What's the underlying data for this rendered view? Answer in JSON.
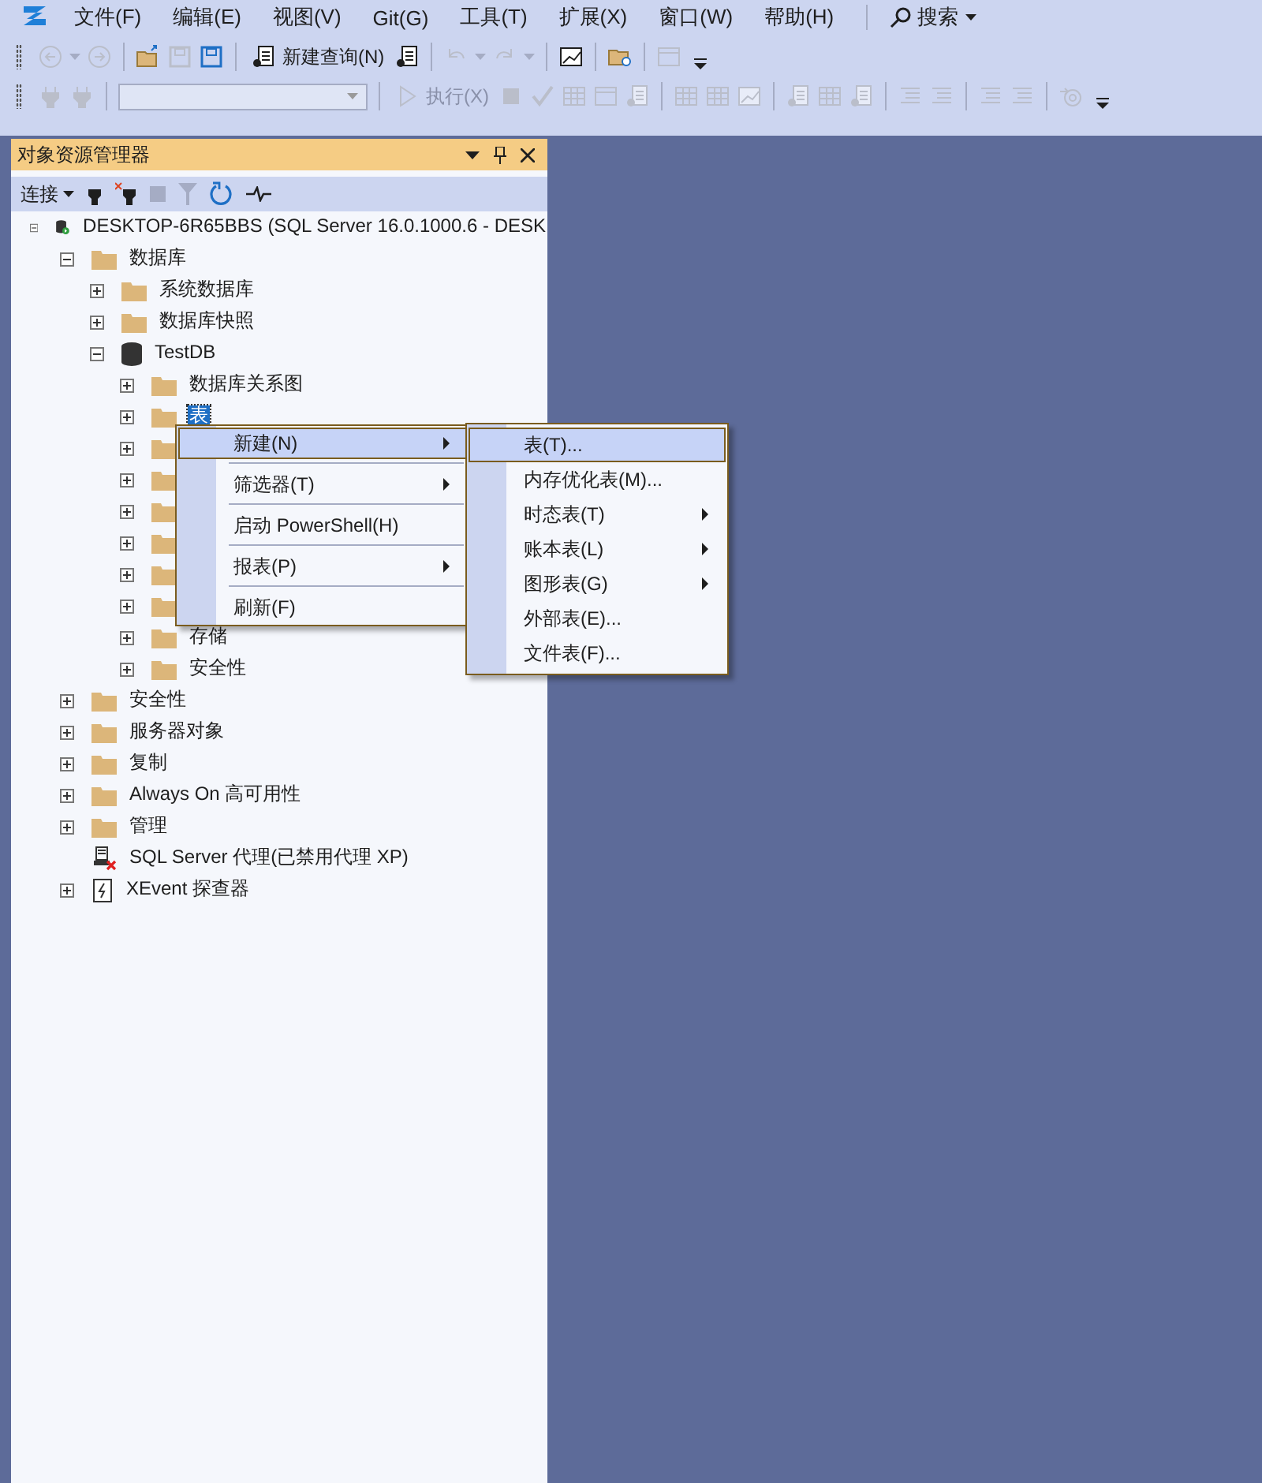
{
  "menu_bar": {
    "items": [
      "文件(F)",
      "编辑(E)",
      "视图(V)",
      "Git(G)",
      "工具(T)",
      "扩展(X)",
      "窗口(W)",
      "帮助(H)"
    ],
    "search": "搜索"
  },
  "toolbar_1": [
    {
      "kind": "icon",
      "disabled": true
    },
    {
      "kind": "caret",
      "disabled": true
    },
    {
      "kind": "icon",
      "disabled": true
    },
    {
      "kind": "separator"
    },
    {
      "kind": "icon",
      "disabled": false
    },
    {
      "kind": "icon",
      "disabled": true
    },
    {
      "kind": "icon",
      "disabled": false
    },
    {
      "kind": "separator"
    },
    {
      "kind": "button",
      "label": "新建查询(N)",
      "disabled": false
    },
    {
      "kind": "icon",
      "disabled": false
    },
    {
      "kind": "separator"
    },
    {
      "kind": "icon",
      "disabled": true
    },
    {
      "kind": "caret",
      "disabled": true
    },
    {
      "kind": "icon",
      "disabled": true
    },
    {
      "kind": "caret",
      "disabled": true
    },
    {
      "kind": "separator"
    },
    {
      "kind": "icon",
      "disabled": false
    },
    {
      "kind": "separator"
    },
    {
      "kind": "icon",
      "disabled": false
    },
    {
      "kind": "separator"
    },
    {
      "kind": "icon",
      "disabled": true
    },
    {
      "kind": "overflow"
    }
  ],
  "toolbar_2": [
    {
      "kind": "icon",
      "disabled": true
    },
    {
      "kind": "icon",
      "disabled": true
    },
    {
      "kind": "separator"
    },
    {
      "kind": "combo",
      "disabled": true
    },
    {
      "kind": "separator"
    },
    {
      "kind": "button",
      "label": "执行(X)",
      "disabled": true
    },
    {
      "kind": "icon",
      "disabled": true
    },
    {
      "kind": "icon",
      "disabled": true
    },
    {
      "kind": "icon",
      "disabled": true
    },
    {
      "kind": "icon",
      "disabled": true
    },
    {
      "kind": "icon",
      "disabled": true
    },
    {
      "kind": "separator"
    },
    {
      "kind": "icon",
      "disabled": true
    },
    {
      "kind": "icon",
      "disabled": true
    },
    {
      "kind": "icon",
      "disabled": true
    },
    {
      "kind": "separator"
    },
    {
      "kind": "icon",
      "disabled": true
    },
    {
      "kind": "icon",
      "disabled": true
    },
    {
      "kind": "icon",
      "disabled": true
    },
    {
      "kind": "separator"
    },
    {
      "kind": "icon",
      "disabled": true
    },
    {
      "kind": "icon",
      "disabled": true
    },
    {
      "kind": "separator"
    },
    {
      "kind": "icon",
      "disabled": true
    },
    {
      "kind": "icon",
      "disabled": true
    },
    {
      "kind": "separator"
    },
    {
      "kind": "icon",
      "disabled": true
    },
    {
      "kind": "overflow"
    }
  ],
  "object_explorer": {
    "title": "对象资源管理器",
    "connect": "连接",
    "tree": [
      {
        "label": "DESKTOP-6R65BBS (SQL Server 16.0.1000.6 - DESK",
        "kind": "server",
        "expanded": true,
        "children": [
          {
            "label": "数据库",
            "kind": "folder",
            "expanded": true,
            "children": [
              {
                "label": "系统数据库",
                "kind": "folder",
                "expanded": false
              },
              {
                "label": "数据库快照",
                "kind": "folder",
                "expanded": false
              },
              {
                "label": "TestDB",
                "kind": "database",
                "expanded": true,
                "children": [
                  {
                    "label": "数据库关系图",
                    "kind": "folder",
                    "expanded": false
                  },
                  {
                    "label": "表",
                    "kind": "folder",
                    "expanded": false,
                    "selected": true
                  },
                  {
                    "kind": "folder",
                    "expanded": false
                  },
                  {
                    "kind": "folder",
                    "expanded": false
                  },
                  {
                    "kind": "folder",
                    "expanded": false
                  },
                  {
                    "kind": "folder",
                    "expanded": false
                  },
                  {
                    "kind": "folder",
                    "expanded": false
                  },
                  {
                    "kind": "folder",
                    "expanded": false
                  },
                  {
                    "label": "存储",
                    "kind": "folder",
                    "expanded": false
                  },
                  {
                    "label": "安全性",
                    "kind": "folder",
                    "expanded": false
                  }
                ]
              }
            ]
          },
          {
            "label": "安全性",
            "kind": "folder",
            "expanded": false
          },
          {
            "label": "服务器对象",
            "kind": "folder",
            "expanded": false
          },
          {
            "label": "复制",
            "kind": "folder",
            "expanded": false
          },
          {
            "label": "Always On 高可用性",
            "kind": "folder",
            "expanded": false
          },
          {
            "label": "管理",
            "kind": "folder",
            "expanded": false
          },
          {
            "label": "SQL Server 代理(已禁用代理 XP)",
            "kind": "agent"
          },
          {
            "label": "XEvent 探查器",
            "kind": "xevent",
            "expanded": false
          }
        ]
      }
    ]
  },
  "context_menu": [
    {
      "kind": "item",
      "label": "新建(N)",
      "submenu": true,
      "selected": true
    },
    {
      "kind": "separator"
    },
    {
      "kind": "item",
      "label": "筛选器(T)",
      "submenu": true,
      "selected": false
    },
    {
      "kind": "separator"
    },
    {
      "kind": "item",
      "label": "启动 PowerShell(H)",
      "submenu": false,
      "selected": false
    },
    {
      "kind": "separator"
    },
    {
      "kind": "item",
      "label": "报表(P)",
      "submenu": true,
      "selected": false
    },
    {
      "kind": "separator"
    },
    {
      "kind": "item",
      "label": "刷新(F)",
      "submenu": false,
      "selected": false
    }
  ],
  "submenu": [
    {
      "kind": "item",
      "label": "表(T)...",
      "submenu": false,
      "selected": true
    },
    {
      "kind": "item",
      "label": "内存优化表(M)...",
      "submenu": false,
      "selected": false
    },
    {
      "kind": "item",
      "label": "时态表(T)",
      "submenu": true,
      "selected": false
    },
    {
      "kind": "item",
      "label": "账本表(L)",
      "submenu": true,
      "selected": false
    },
    {
      "kind": "item",
      "label": "图形表(G)",
      "submenu": true,
      "selected": false
    },
    {
      "kind": "item",
      "label": "外部表(E)...",
      "submenu": false,
      "selected": false
    },
    {
      "kind": "item",
      "label": "文件表(F)...",
      "submenu": false,
      "selected": false
    }
  ]
}
